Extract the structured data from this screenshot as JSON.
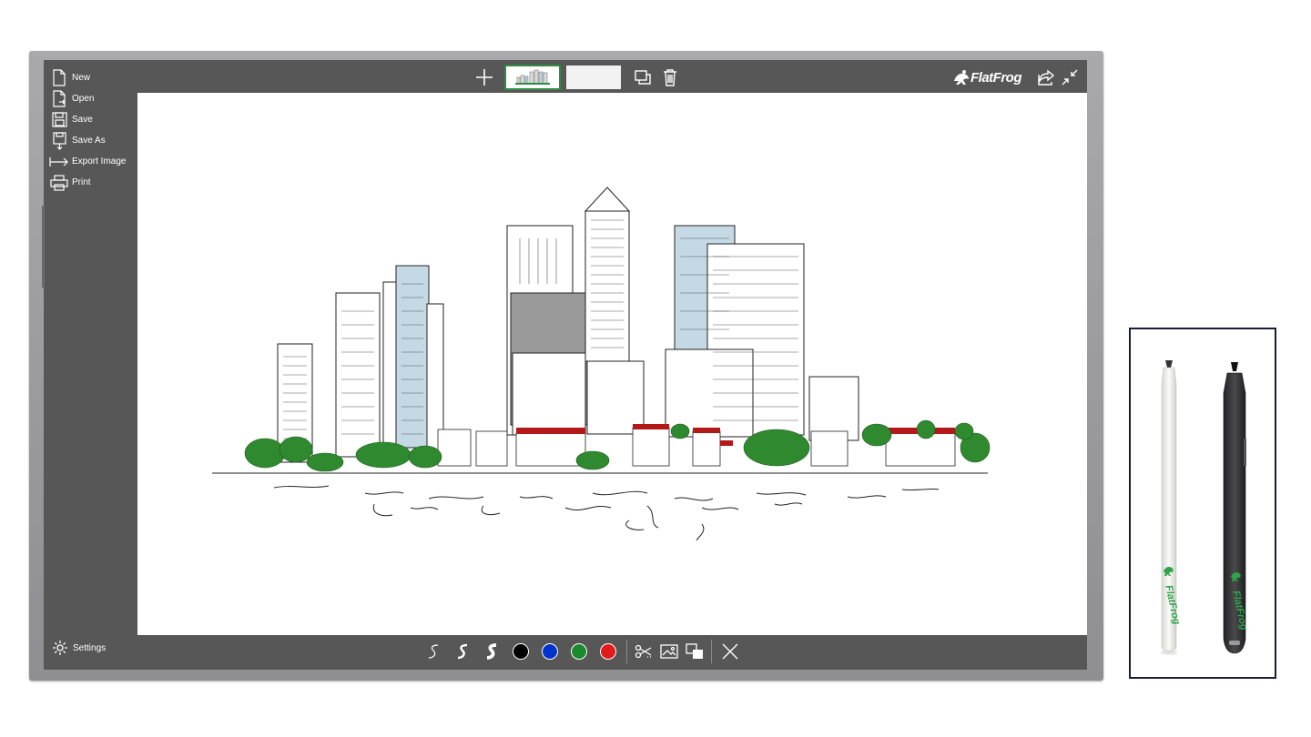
{
  "menu": {
    "items": [
      {
        "label": "New",
        "icon": "new-document-icon"
      },
      {
        "label": "Open",
        "icon": "open-document-icon"
      },
      {
        "label": "Save",
        "icon": "save-icon"
      },
      {
        "label": "Save As",
        "icon": "save-as-icon"
      },
      {
        "label": "Export Image",
        "icon": "export-arrow-icon"
      },
      {
        "label": "Print",
        "icon": "printer-icon"
      }
    ],
    "settings_label": "Settings"
  },
  "topbar": {
    "add_page_icon": "plus-icon",
    "duplicate_icon": "duplicate-icon",
    "delete_icon": "trash-icon",
    "pages": [
      {
        "state": "active",
        "content": "city-sketch-thumbnail"
      },
      {
        "state": "inactive",
        "content": "blank"
      }
    ]
  },
  "brand": {
    "name": "FlatFrog",
    "logo_icon": "frog-logo-icon",
    "share_icon": "share-icon",
    "minimize_icon": "minimize-arrows-icon"
  },
  "bottombar": {
    "pens": [
      "thin-pen-icon",
      "medium-pen-icon",
      "thick-pen-icon"
    ],
    "colors": [
      "#000000",
      "#0033cc",
      "#1a8a2e",
      "#e01b1b"
    ],
    "tools": [
      "scissors-icon",
      "image-icon",
      "layers-icon"
    ],
    "close_icon": "close-icon"
  },
  "canvas": {
    "background": "#ffffff",
    "content": "city-skyline-sketch"
  },
  "pens_panel": {
    "items": [
      {
        "color": "#f2f2ef",
        "brand": "FlatFrog"
      },
      {
        "color": "#3a3a3c",
        "brand": "FlatFrog"
      }
    ],
    "accent": "#2fa44a"
  }
}
